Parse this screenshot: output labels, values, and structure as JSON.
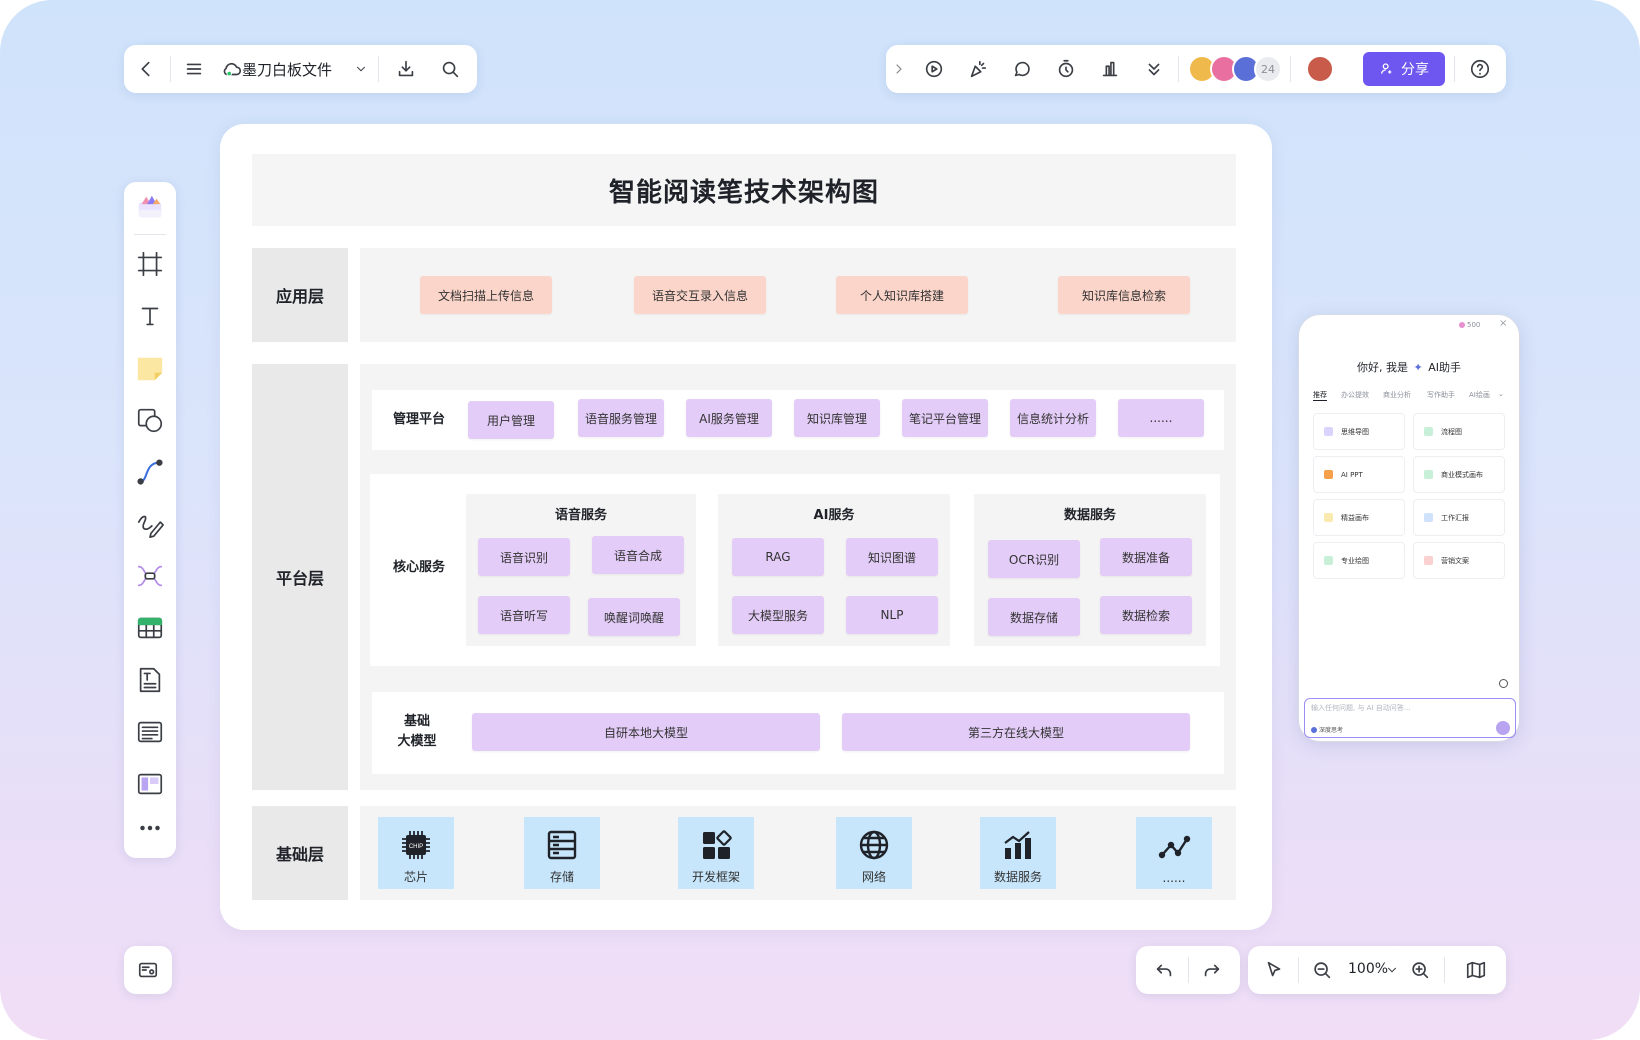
{
  "toolbar": {
    "file_name": "墨刀白板文件",
    "collaborator_count": "24",
    "share_label": "分享",
    "zoom_level": "100%"
  },
  "colors": {
    "accent": "#6e56f0",
    "app_layer_pill": "#fbd5c9",
    "platform_pill": "#e3ccf7",
    "infra_card": "#c8e6fb"
  },
  "left_tools": [
    "template-icon",
    "frame-icon",
    "text-icon",
    "sticky-note-icon",
    "shape-icon",
    "connector-icon",
    "pen-icon",
    "mindmap-icon",
    "table-icon",
    "document-icon",
    "list-icon",
    "layout-icon",
    "more-icon"
  ],
  "diagram": {
    "title": "智能阅读笔技术架构图",
    "app_layer": {
      "label": "应用层",
      "items": [
        "文档扫描上传信息",
        "语音交互录入信息",
        "个人知识库搭建",
        "知识库信息检索"
      ]
    },
    "platform_layer": {
      "label": "平台层",
      "management": {
        "label": "管理平台",
        "items": [
          "用户管理",
          "语音服务管理",
          "AI服务管理",
          "知识库管理",
          "笔记平台管理",
          "信息统计分析",
          "......"
        ]
      },
      "core": {
        "label": "核心服务",
        "groups": [
          {
            "title": "语音服务",
            "items": [
              "语音识别",
              "语音合成",
              "语音听写",
              "唤醒词唤醒"
            ]
          },
          {
            "title": "AI服务",
            "items": [
              "RAG",
              "知识图谱",
              "大模型服务",
              "NLP"
            ]
          },
          {
            "title": "数据服务",
            "items": [
              "OCR识别",
              "数据准备",
              "数据存储",
              "数据检索"
            ]
          }
        ]
      },
      "models": {
        "label_line1": "基础",
        "label_line2": "大模型",
        "items": [
          "自研本地大模型",
          "第三方在线大模型"
        ]
      }
    },
    "infra_layer": {
      "label": "基础层",
      "items": [
        {
          "label": "芯片",
          "icon": "chip-icon",
          "icon_text": "CHIP"
        },
        {
          "label": "存储",
          "icon": "storage-icon"
        },
        {
          "label": "开发框架",
          "icon": "framework-icon"
        },
        {
          "label": "网络",
          "icon": "globe-icon"
        },
        {
          "label": "数据服务",
          "icon": "bar-chart-icon"
        },
        {
          "label": "......",
          "icon": "network-graph-icon"
        }
      ]
    }
  },
  "ai_panel": {
    "points": "500",
    "greeting_prefix": "你好, 我是",
    "assistant_name": "AI助手",
    "tabs": [
      "推荐",
      "办公提效",
      "商业分析",
      "写作助手",
      "AI绘画"
    ],
    "tiles": [
      "思维导图",
      "流程图",
      "AI PPT",
      "商业模式画布",
      "精益画布",
      "工作汇报",
      "专业绘图",
      "营销文案"
    ],
    "input_placeholder": "输入任何问题, 与 AI 自动问答...",
    "deep_think_label": "深度思考"
  }
}
